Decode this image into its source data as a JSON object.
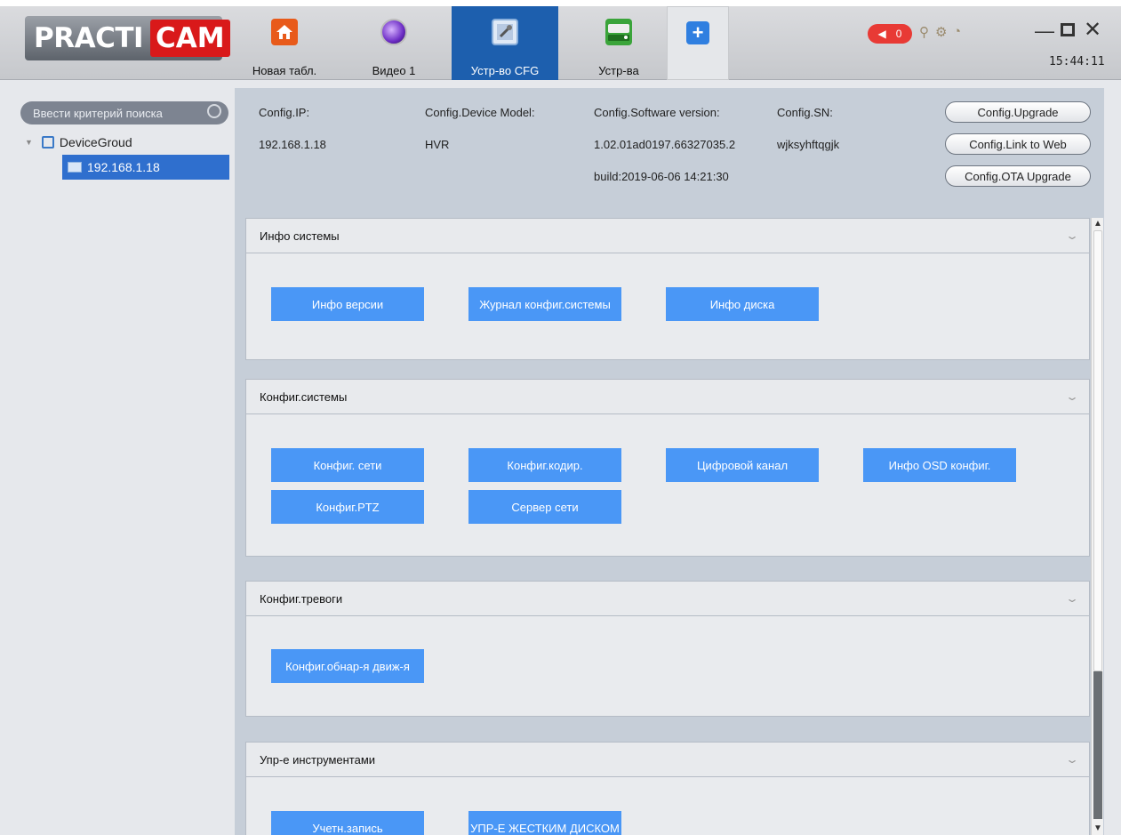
{
  "brand": {
    "logo_left": "PRACTI",
    "logo_right": "CAM"
  },
  "tabs": [
    {
      "label": "Новая табл.",
      "icon": "home-icon",
      "active": false
    },
    {
      "label": "Видео 1",
      "icon": "camera-lens-icon",
      "active": false
    },
    {
      "label": "Устр-во CFG",
      "icon": "config-tool-icon",
      "active": true
    },
    {
      "label": "Устр-ва",
      "icon": "device-recorder-icon",
      "active": false
    },
    {
      "label": "",
      "icon": "plus-icon",
      "active": false
    }
  ],
  "status": {
    "alarm_count": "0",
    "time": "15:44:11"
  },
  "sidebar": {
    "search_placeholder": "Ввести критерий поиска",
    "group_label": "DeviceGroud",
    "device_label": "192.168.1.18"
  },
  "device_info": {
    "ip_label": "Config.IP:",
    "ip_value": "192.168.1.18",
    "model_label": "Config.Device Model:",
    "model_value": "HVR",
    "software_label": "Config.Software version:",
    "software_value": "1.02.01ad0197.66327035.2",
    "build_value": "build:2019-06-06 14:21:30",
    "sn_label": "Config.SN:",
    "sn_value": "wjksyhftqgjk",
    "btn_upgrade": "Config.Upgrade",
    "btn_link_web": "Config.Link to Web",
    "btn_ota": "Config.OTA Upgrade"
  },
  "sections": [
    {
      "title": "Инфо системы",
      "buttons": [
        "Инфо версии",
        "Журнал конфиг.системы",
        "Инфо диска"
      ]
    },
    {
      "title": "Конфиг.системы",
      "buttons": [
        "Конфиг. сети",
        "Конфиг.кодир.",
        "Цифровой канал",
        "Инфо OSD конфиг.",
        "Конфиг.PTZ",
        "Сервер сети"
      ]
    },
    {
      "title": "Конфиг.тревоги",
      "buttons": [
        "Конфиг.обнар-я движ-я"
      ]
    },
    {
      "title": "Упр-е инструментами",
      "buttons": [
        "Учетн.запись",
        "УПР-Е ЖЕСТКИМ ДИСКОМ"
      ]
    }
  ],
  "colors": {
    "accent_tab": "#1d5fae",
    "function_button": "#4a97f6",
    "alarm": "#e83a35",
    "logo_red": "#d9191a"
  }
}
